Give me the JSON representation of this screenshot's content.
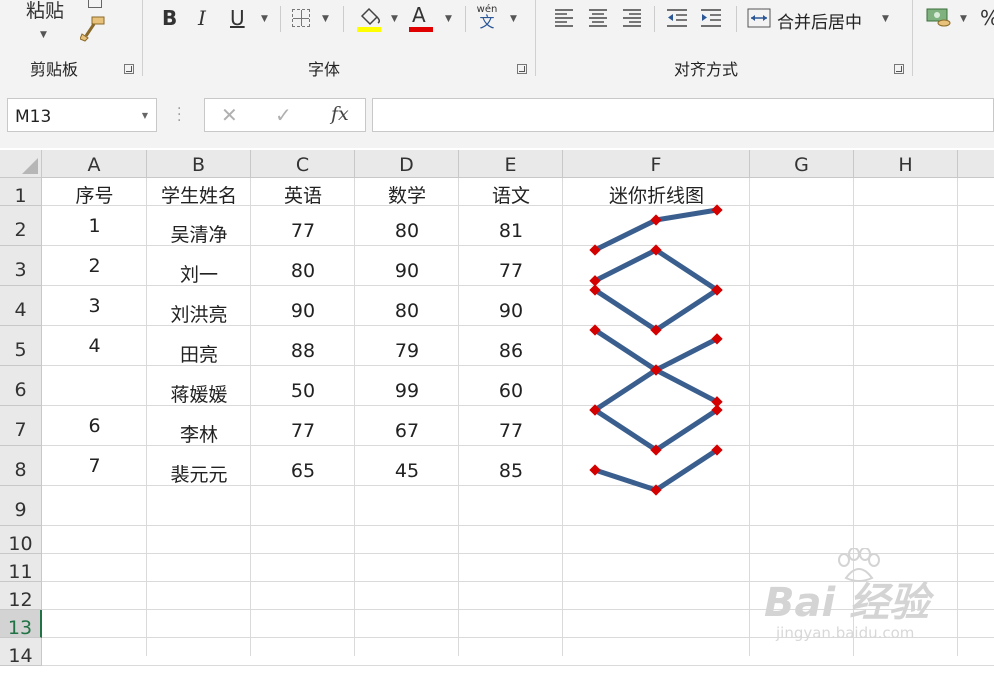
{
  "ribbon": {
    "clipboard": {
      "paste_label": "粘贴",
      "group_label": "剪贴板"
    },
    "font": {
      "bold": "B",
      "italic": "I",
      "underline": "U",
      "font_color_glyph": "A",
      "phonetic_top": "wén",
      "phonetic_bottom": "文",
      "group_label": "字体",
      "fill_color": "#ffff00",
      "font_color": "#e00000"
    },
    "alignment": {
      "merge_center_label": "合并后居中",
      "group_label": "对齐方式"
    },
    "number": {
      "percent": "%"
    }
  },
  "formula_bar": {
    "name_box": "M13",
    "cancel": "✕",
    "enter": "✓",
    "fx": "fx",
    "formula": ""
  },
  "sheet": {
    "columns": [
      "A",
      "B",
      "C",
      "D",
      "E",
      "F",
      "G",
      "H"
    ],
    "rows": [
      "1",
      "2",
      "3",
      "4",
      "5",
      "6",
      "7",
      "8",
      "9",
      "10",
      "11",
      "12",
      "13",
      "14"
    ],
    "selected_row": "13",
    "header_row": [
      "序号",
      "学生姓名",
      "英语",
      "数学",
      "语文",
      "迷你折线图"
    ],
    "data_rows": [
      [
        "1",
        "吴清净",
        "77",
        "80",
        "81"
      ],
      [
        "2",
        "刘一",
        "80",
        "90",
        "77"
      ],
      [
        "3",
        "刘洪亮",
        "90",
        "80",
        "90"
      ],
      [
        "4",
        "田亮",
        "88",
        "79",
        "86"
      ],
      [
        "",
        "蒋媛媛",
        "50",
        "99",
        "60"
      ],
      [
        "6",
        "李林",
        "77",
        "67",
        "77"
      ],
      [
        "7",
        "裴元元",
        "65",
        "45",
        "85"
      ]
    ],
    "sparkline": {
      "line_color": "#3a5f8f",
      "marker_color": "#d40000"
    }
  },
  "watermark": {
    "main": "Bai 经验",
    "sub": "jingyan.baidu.com"
  }
}
